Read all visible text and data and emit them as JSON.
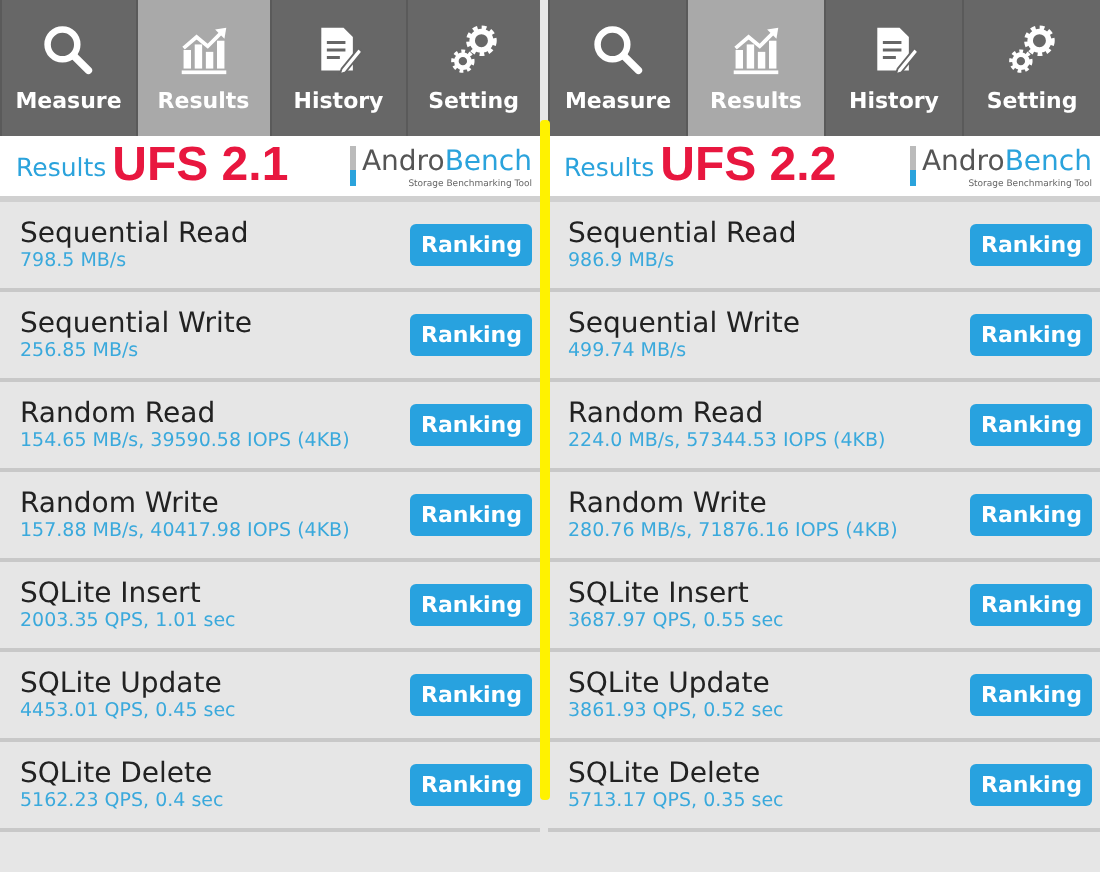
{
  "panels": [
    {
      "tabs": [
        {
          "label": "Measure",
          "selected": false
        },
        {
          "label": "Results",
          "selected": true
        },
        {
          "label": "History",
          "selected": false
        },
        {
          "label": "Setting",
          "selected": false
        }
      ],
      "header": {
        "title": "Results",
        "version": "UFS 2.1",
        "logo": {
          "name_first": "Andro",
          "name_second": "Bench",
          "tagline": "Storage Benchmarking Tool"
        }
      },
      "results": [
        {
          "name": "Sequential Read",
          "value": "798.5 MB/s",
          "button": "Ranking"
        },
        {
          "name": "Sequential Write",
          "value": "256.85 MB/s",
          "button": "Ranking"
        },
        {
          "name": "Random Read",
          "value": "154.65 MB/s, 39590.58 IOPS (4KB)",
          "button": "Ranking"
        },
        {
          "name": "Random Write",
          "value": "157.88 MB/s, 40417.98 IOPS (4KB)",
          "button": "Ranking"
        },
        {
          "name": "SQLite Insert",
          "value": "2003.35 QPS, 1.01 sec",
          "button": "Ranking"
        },
        {
          "name": "SQLite Update",
          "value": "4453.01 QPS, 0.45 sec",
          "button": "Ranking"
        },
        {
          "name": "SQLite Delete",
          "value": "5162.23 QPS, 0.4 sec",
          "button": "Ranking"
        }
      ]
    },
    {
      "tabs": [
        {
          "label": "Measure",
          "selected": false
        },
        {
          "label": "Results",
          "selected": true
        },
        {
          "label": "History",
          "selected": false
        },
        {
          "label": "Setting",
          "selected": false
        }
      ],
      "header": {
        "title": "Results",
        "version": "UFS 2.2",
        "logo": {
          "name_first": "Andro",
          "name_second": "Bench",
          "tagline": "Storage Benchmarking Tool"
        }
      },
      "results": [
        {
          "name": "Sequential Read",
          "value": "986.9 MB/s",
          "button": "Ranking"
        },
        {
          "name": "Sequential Write",
          "value": "499.74 MB/s",
          "button": "Ranking"
        },
        {
          "name": "Random Read",
          "value": "224.0 MB/s, 57344.53 IOPS (4KB)",
          "button": "Ranking"
        },
        {
          "name": "Random Write",
          "value": "280.76 MB/s, 71876.16 IOPS (4KB)",
          "button": "Ranking"
        },
        {
          "name": "SQLite Insert",
          "value": "3687.97 QPS, 0.55 sec",
          "button": "Ranking"
        },
        {
          "name": "SQLite Update",
          "value": "3861.93 QPS, 0.52 sec",
          "button": "Ranking"
        },
        {
          "name": "SQLite Delete",
          "value": "5713.17 QPS, 0.35 sec",
          "button": "Ranking"
        }
      ]
    }
  ]
}
